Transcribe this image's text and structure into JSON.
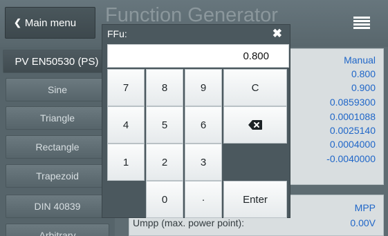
{
  "header": {
    "back_label": "Main menu",
    "title": "Function Generator"
  },
  "left_list": {
    "items": [
      {
        "label": "PV EN50530 (PS)",
        "selected": true
      },
      {
        "label": "Sine"
      },
      {
        "label": "Triangle"
      },
      {
        "label": "Rectangle"
      },
      {
        "label": "Trapezoid"
      },
      {
        "label": "DIN 40839"
      },
      {
        "label": "Arbitrary"
      }
    ]
  },
  "panel_top": {
    "mode": "Manual",
    "values": [
      "0.800",
      "0.900",
      "0.0859300",
      "0.0001088",
      "0.0025140",
      "0.0004000",
      "-0.0040000"
    ]
  },
  "panel_bottom": {
    "mode": "MPP",
    "umpp_label": "Umpp (max. power point):",
    "umpp_value": "0.00V"
  },
  "keypad": {
    "title": "FFu:",
    "close_symbol": "✖",
    "display_value": "0.800",
    "keys": {
      "k7": "7",
      "k8": "8",
      "k9": "9",
      "clear": "C",
      "k4": "4",
      "k5": "5",
      "k6": "6",
      "k1": "1",
      "k2": "2",
      "k3": "3",
      "k0": "0",
      "dot": "·",
      "enter": "Enter"
    }
  },
  "colors": {
    "value_blue": "#1f66c8",
    "header_bg": "#5e6c72"
  }
}
